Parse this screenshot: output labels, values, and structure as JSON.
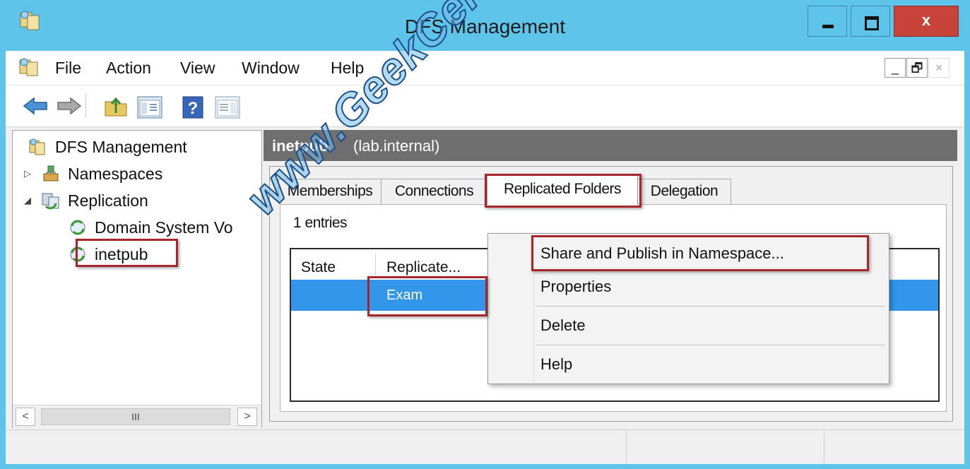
{
  "window": {
    "title": "DFS Management",
    "close_glyph": "x"
  },
  "menubar": {
    "items": [
      "File",
      "Action",
      "View",
      "Window",
      "Help"
    ],
    "mdi": {
      "minimize": "_",
      "restore": "🗗",
      "close": "×"
    }
  },
  "toolbar": {
    "icons": [
      "back-arrow-icon",
      "forward-arrow-icon",
      "up-folder-icon",
      "show-hide-console-tree-icon",
      "help-icon",
      "show-hide-action-pane-icon"
    ],
    "help_glyph": "?"
  },
  "tree": {
    "root": "DFS Management",
    "namespaces": "Namespaces",
    "replication": "Replication",
    "children": [
      "Domain System Vo",
      "inetpub"
    ],
    "scroll": {
      "left": "<",
      "right": ">",
      "thumb": "III"
    }
  },
  "detail": {
    "title": "inetpub",
    "subtitle": "(lab.internal)",
    "tabs": [
      "Memberships",
      "Connections",
      "Replicated Folders",
      "Delegation"
    ],
    "active_tab": "Replicated Folders",
    "entries": "1 entries",
    "columns": [
      "State",
      "Replicate..."
    ],
    "row": {
      "replicated_folder": "Exam"
    }
  },
  "context_menu": {
    "items": [
      "Share and Publish in Namespace...",
      "Properties",
      "Delete",
      "Help"
    ]
  },
  "watermark": "www.GeekCert.com",
  "colors": {
    "title_bar": "#5ec4ea",
    "selection": "#3396ea",
    "close_button": "#c8433a",
    "highlight_box": "#a7262b",
    "header": "#6f6f6f"
  }
}
